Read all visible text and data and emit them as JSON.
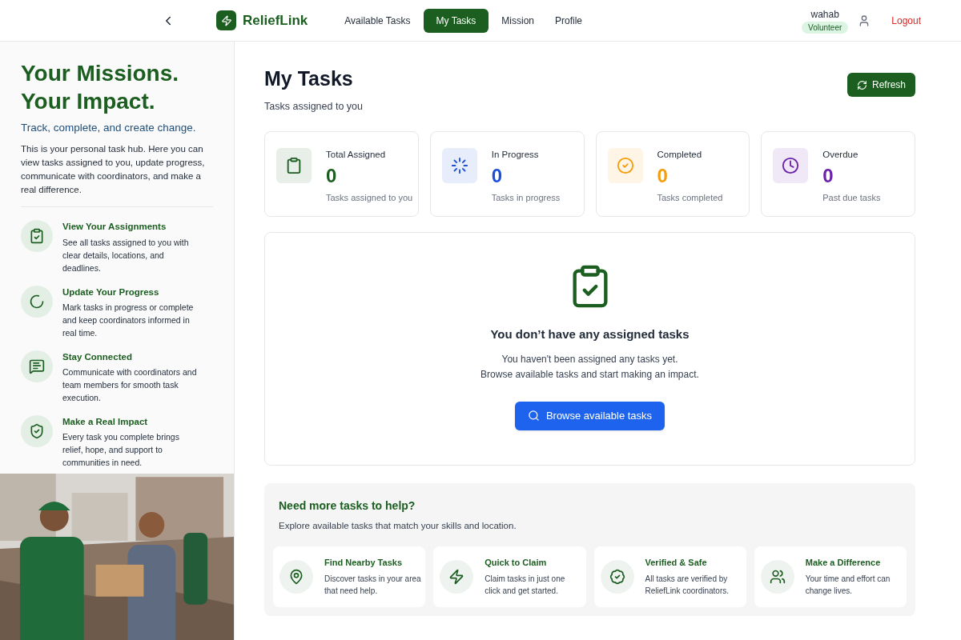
{
  "header": {
    "brand": "ReliefLink",
    "nav": [
      {
        "label": "Available Tasks",
        "selected": false
      },
      {
        "label": "My Tasks",
        "selected": true
      },
      {
        "label": "Mission",
        "selected": false
      },
      {
        "label": "Profile",
        "selected": false
      }
    ],
    "user": {
      "name": "wahab",
      "role": "Volunteer"
    },
    "logout": "Logout"
  },
  "sidebar": {
    "title_lines": [
      "Your Missions.",
      "Your Impact."
    ],
    "tagline": "Track, complete, and create change.",
    "intro": "This is your personal task hub. Here you can view tasks assigned to you, update progress, communicate with coordinators, and make a real difference.",
    "features": [
      {
        "kind": "clipboard",
        "title": "View Your Assignments",
        "text": "See all tasks assigned to you with clear details, locations, and deadlines."
      },
      {
        "kind": "progress",
        "title": "Update Your Progress",
        "text": "Mark tasks in progress or complete and keep coordinators informed in real time."
      },
      {
        "kind": "chat",
        "title": "Stay Connected",
        "text": "Communicate with coordinators and team members for smooth task execution."
      },
      {
        "kind": "shield",
        "title": "Make a Real Impact",
        "text": "Every task you complete brings relief, hope, and support to communities in need."
      }
    ]
  },
  "main": {
    "title": "My Tasks",
    "subtitle": "Tasks assigned to you",
    "refresh": "Refresh",
    "stats": [
      {
        "kind": "clipboard",
        "color": "#1b5e20",
        "label": "Total Assigned",
        "value": "0",
        "caption": "Tasks assigned to you"
      },
      {
        "kind": "loader",
        "color": "#1d4ed8",
        "label": "In Progress",
        "value": "0",
        "caption": "Tasks in progress"
      },
      {
        "kind": "check",
        "color": "#f59e0b",
        "label": "Completed",
        "value": "0",
        "caption": "Tasks completed"
      },
      {
        "kind": "clock",
        "color": "#6b21a8",
        "label": "Overdue",
        "value": "0",
        "caption": "Past due tasks"
      }
    ],
    "empty": {
      "title": "You don’t have any assigned tasks",
      "lines": [
        "You haven't been assigned any tasks yet.",
        "Browse available tasks and start making an impact."
      ],
      "button": "Browse available tasks"
    },
    "more": {
      "title": "Need more tasks to help?",
      "text": "Explore available tasks that match your skills and location.",
      "items": [
        {
          "kind": "pin",
          "title": "Find Nearby Tasks",
          "text": "Discover tasks in your area that need help."
        },
        {
          "kind": "zap",
          "title": "Quick to Claim",
          "text": "Claim tasks in just one click and get started."
        },
        {
          "kind": "badge",
          "title": "Verified & Safe",
          "text": "All tasks are verified by ReliefLink coordinators."
        },
        {
          "kind": "people",
          "title": "Make a Difference",
          "text": "Your time and effort can change lives."
        }
      ]
    }
  }
}
